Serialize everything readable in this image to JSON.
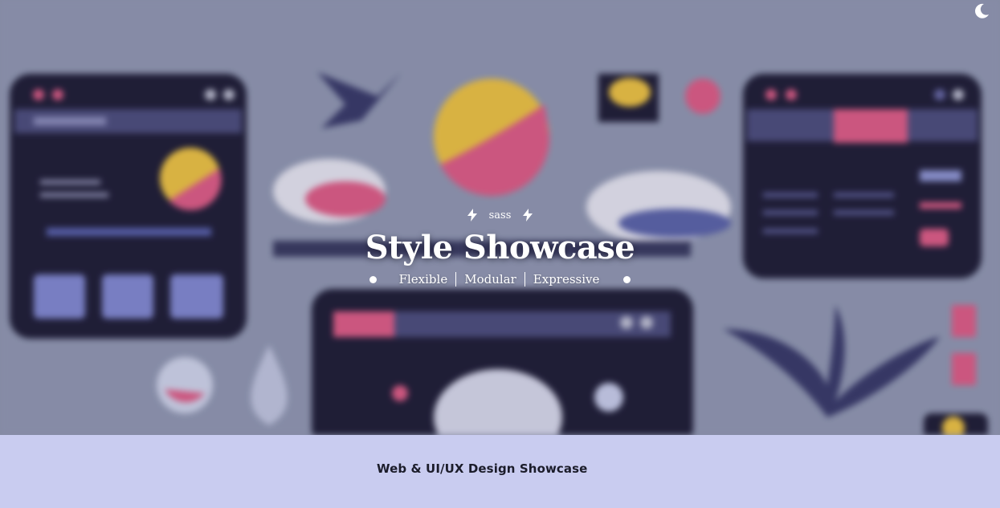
{
  "hero": {
    "tag": "sass",
    "tag_icon": "lightning-bolt-icon",
    "title": "Style Showcase",
    "subtitle_items": [
      "Flexible",
      "Modular",
      "Expressive"
    ]
  },
  "theme_toggle": {
    "icon": "moon-icon"
  },
  "footer": {
    "text": "Web & UI/UX Design Showcase"
  },
  "colors": {
    "hero_bg": "#8a90a8",
    "footer_bg": "#c9ccf0",
    "accent_pink": "#e0507a",
    "accent_yellow": "#f0c030",
    "panel_dark": "#0e0b22",
    "panel_blue": "#404070"
  }
}
